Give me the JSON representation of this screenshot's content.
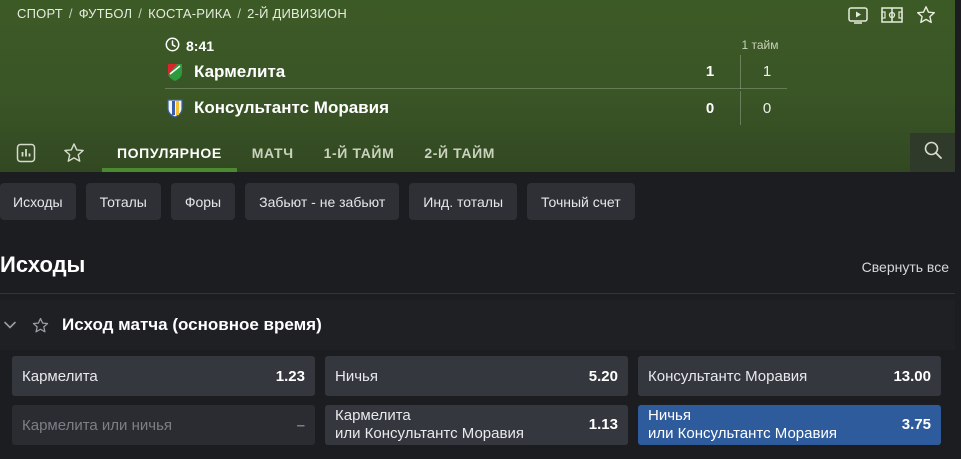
{
  "breadcrumb": [
    "СПОРТ",
    "ФУТБОЛ",
    "КОСТА-РИКА",
    "2-Й ДИВИЗИОН"
  ],
  "hero_icons": [
    "video-icon",
    "field-icon",
    "star-icon"
  ],
  "match": {
    "time": "8:41",
    "half_label": "1 тайм",
    "teams": [
      {
        "name": "Кармелита",
        "score": "1",
        "half": "1",
        "logo_colors": [
          "#d8262d",
          "#2d9a3e"
        ]
      },
      {
        "name": "Консультантс Моравия",
        "score": "0",
        "half": "0",
        "logo_colors": [
          "#3a5ea8",
          "#f2c230"
        ]
      }
    ]
  },
  "tabs": [
    {
      "label": "ПОПУЛЯРНОЕ",
      "active": true
    },
    {
      "label": "МАТЧ",
      "active": false
    },
    {
      "label": "1-Й ТАЙМ",
      "active": false
    },
    {
      "label": "2-Й ТАЙМ",
      "active": false
    }
  ],
  "filters": [
    "Исходы",
    "Тоталы",
    "Форы",
    "Забьют - не забьют",
    "Инд. тоталы",
    "Точный счет"
  ],
  "section": {
    "title": "Исходы",
    "collapse_label": "Свернуть все"
  },
  "market": {
    "name": "Исход матча (основное время)"
  },
  "odds": [
    {
      "line1": "Кармелита",
      "line2": "",
      "value": "1.23",
      "state": "normal"
    },
    {
      "line1": "Ничья",
      "line2": "",
      "value": "5.20",
      "state": "normal"
    },
    {
      "line1": "Консультантс Моравия",
      "line2": "",
      "value": "13.00",
      "state": "normal"
    },
    {
      "line1": "Кармелита или ничья",
      "line2": "",
      "value": "–",
      "state": "disabled"
    },
    {
      "line1": "Кармелита",
      "line2": "или Консультантс Моравия",
      "value": "1.13",
      "state": "normal"
    },
    {
      "line1": "Ничья",
      "line2": "или Консультантс Моравия",
      "value": "3.75",
      "state": "selected"
    }
  ],
  "colors": {
    "accent_green": "#4b8a2f",
    "selected_blue": "#2e5b9c",
    "hero_green": "#3c5a26"
  }
}
